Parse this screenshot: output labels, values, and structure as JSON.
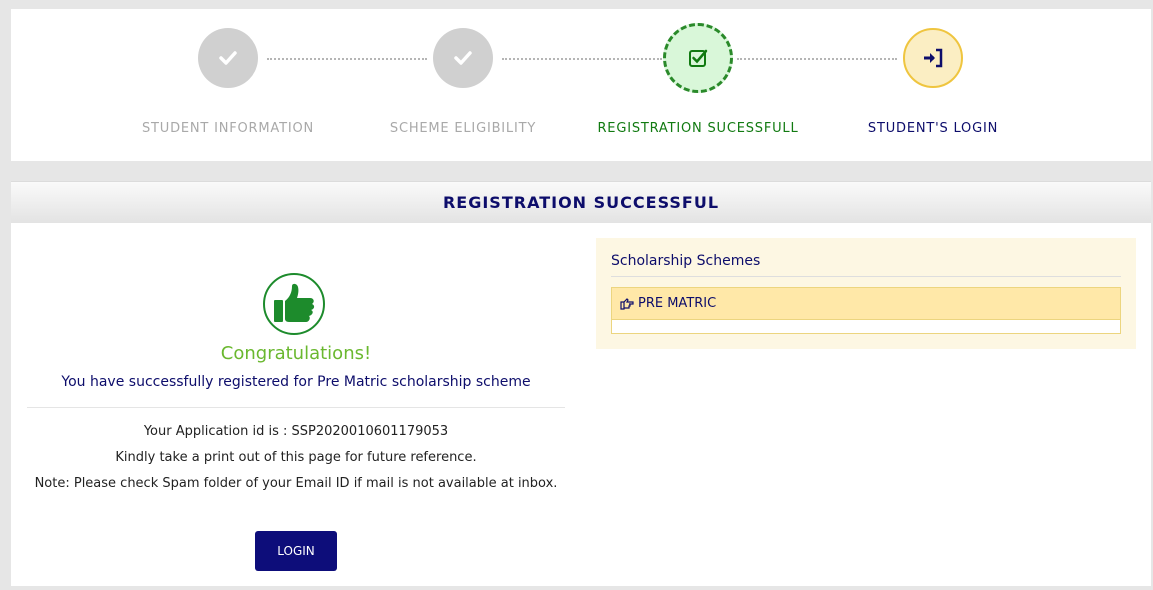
{
  "stepper": {
    "steps": [
      {
        "label": "STUDENT INFORMATION",
        "state": "done",
        "icon": "check-icon"
      },
      {
        "label": "SCHEME ELIGIBILITY",
        "state": "done",
        "icon": "check-icon"
      },
      {
        "label": "REGISTRATION SUCESSFULL",
        "state": "current",
        "icon": "check-square-icon"
      },
      {
        "label": "STUDENT'S LOGIN",
        "state": "next",
        "icon": "sign-in-icon"
      }
    ]
  },
  "panel": {
    "title": "REGISTRATION SUCCESSFUL"
  },
  "result": {
    "icon": "thumbs-up-icon",
    "congrats": "Congratulations!",
    "message": "You have successfully registered for Pre Matric scholarship scheme",
    "application_id_line": "Your Application id is : SSP2020010601179053",
    "print_note": "Kindly take a print out of this page for future reference.",
    "spam_note": "Note: Please check Spam folder of your Email ID if mail is not available at inbox.",
    "login_label": "LOGIN"
  },
  "schemes": {
    "title": "Scholarship Schemes",
    "items": [
      {
        "label": "PRE MATRIC",
        "icon": "hand-pointing-right-icon"
      }
    ]
  },
  "colors": {
    "navy": "#0d0d6b",
    "success_green": "#117a11",
    "congrats_green": "#6ab82f",
    "step_done_gray": "#d0d0d0",
    "step_next_yellow": "#efc53f",
    "login_button": "#0d0d7a"
  }
}
